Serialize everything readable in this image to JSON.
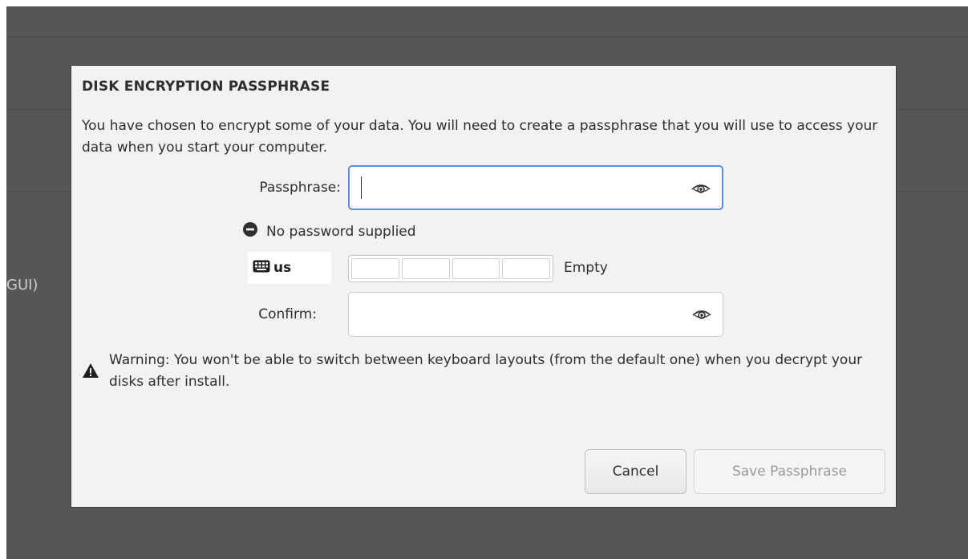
{
  "background": {
    "partial_text": "GUI)"
  },
  "dialog": {
    "title": "DISK ENCRYPTION PASSPHRASE",
    "description": "You have chosen to encrypt some of your data. You will need to create a passphrase that you will use to access your data when you start your computer.",
    "passphrase_label": "Passphrase:",
    "passphrase_value": "",
    "status_text": "No password supplied",
    "keyboard_layout": "us",
    "strength_label": "Empty",
    "confirm_label": "Confirm:",
    "confirm_value": "",
    "warning_text": "Warning: You won't be able to switch between keyboard layouts (from the default one) when you decrypt your disks after install.",
    "cancel_label": "Cancel",
    "save_label": "Save Passphrase"
  },
  "icons": {
    "reveal": "eye-icon",
    "status": "minus-circle-icon",
    "keyboard": "keyboard-icon",
    "warning": "warning-triangle-icon"
  }
}
